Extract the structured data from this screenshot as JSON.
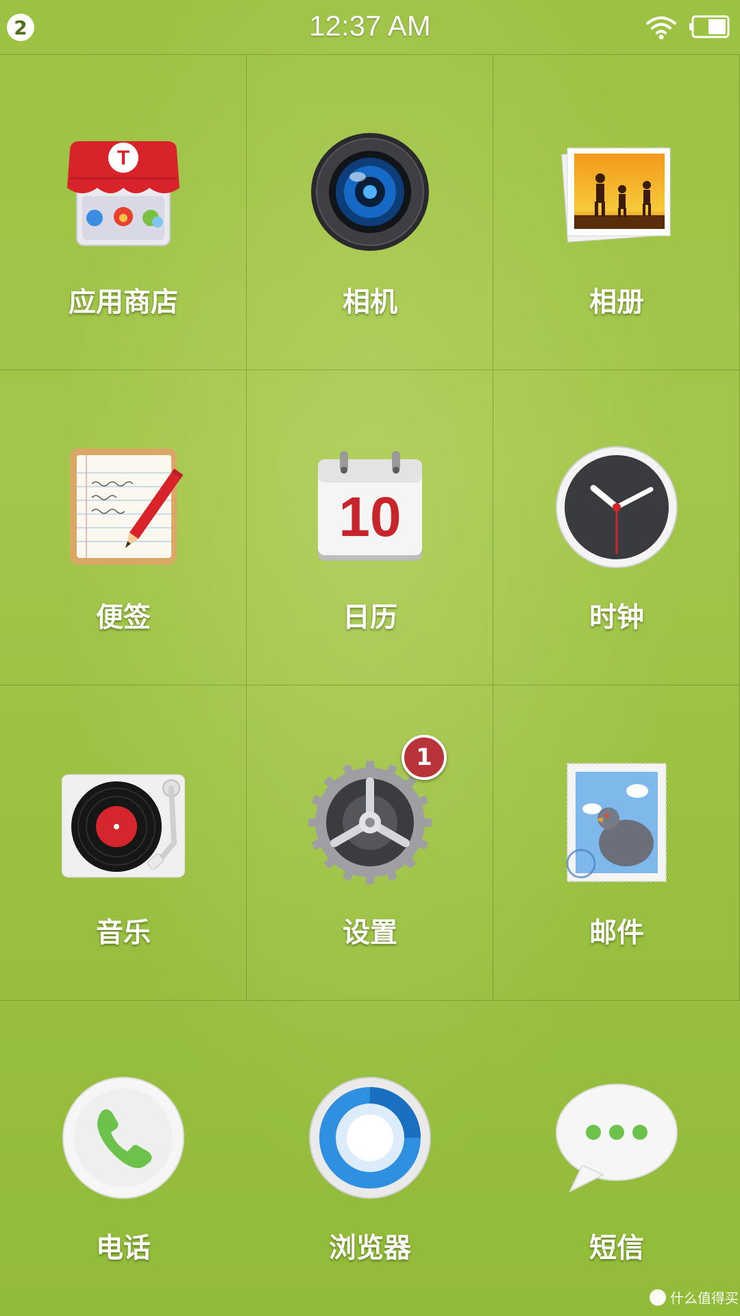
{
  "status_bar": {
    "notification_count": "2",
    "time": "12:37 AM"
  },
  "apps": [
    {
      "label": "应用商店",
      "icon": "app-store-icon"
    },
    {
      "label": "相机",
      "icon": "camera-icon"
    },
    {
      "label": "相册",
      "icon": "gallery-icon"
    },
    {
      "label": "便签",
      "icon": "notes-icon"
    },
    {
      "label": "日历",
      "icon": "calendar-icon",
      "calendar_day": "10"
    },
    {
      "label": "时钟",
      "icon": "clock-icon"
    },
    {
      "label": "音乐",
      "icon": "music-icon"
    },
    {
      "label": "设置",
      "icon": "settings-icon",
      "badge": "1"
    },
    {
      "label": "邮件",
      "icon": "mail-icon"
    }
  ],
  "dock": [
    {
      "label": "电话",
      "icon": "phone-icon"
    },
    {
      "label": "浏览器",
      "icon": "browser-icon"
    },
    {
      "label": "短信",
      "icon": "messages-icon"
    }
  ],
  "store_logo_letter": "T",
  "watermark": "什么值得买",
  "colors": {
    "background": "#9fc345",
    "badge": "#b8343a",
    "label": "#ffffff"
  }
}
